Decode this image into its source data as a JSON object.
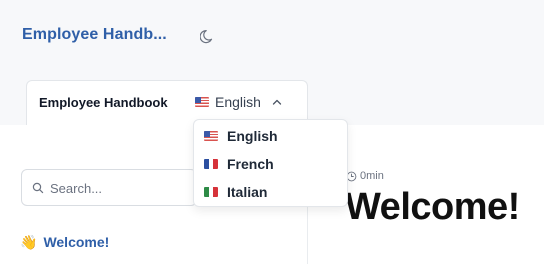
{
  "header": {
    "brand": "Employee Handb..."
  },
  "selector": {
    "title": "Employee Handbook",
    "current_language": "English",
    "current_flag": "us"
  },
  "dropdown": {
    "options": [
      {
        "label": "English",
        "flag": "us"
      },
      {
        "label": "French",
        "flag": "fr"
      },
      {
        "label": "Italian",
        "flag": "it"
      }
    ]
  },
  "sidebar": {
    "search_placeholder": "Search...",
    "items": [
      {
        "emoji": "👋",
        "label": "Welcome!"
      }
    ]
  },
  "main": {
    "read_time": "0min",
    "title": "Welcome!"
  },
  "colors": {
    "brand": "#2f5fa8",
    "header_bg": "#f7f8fa"
  }
}
